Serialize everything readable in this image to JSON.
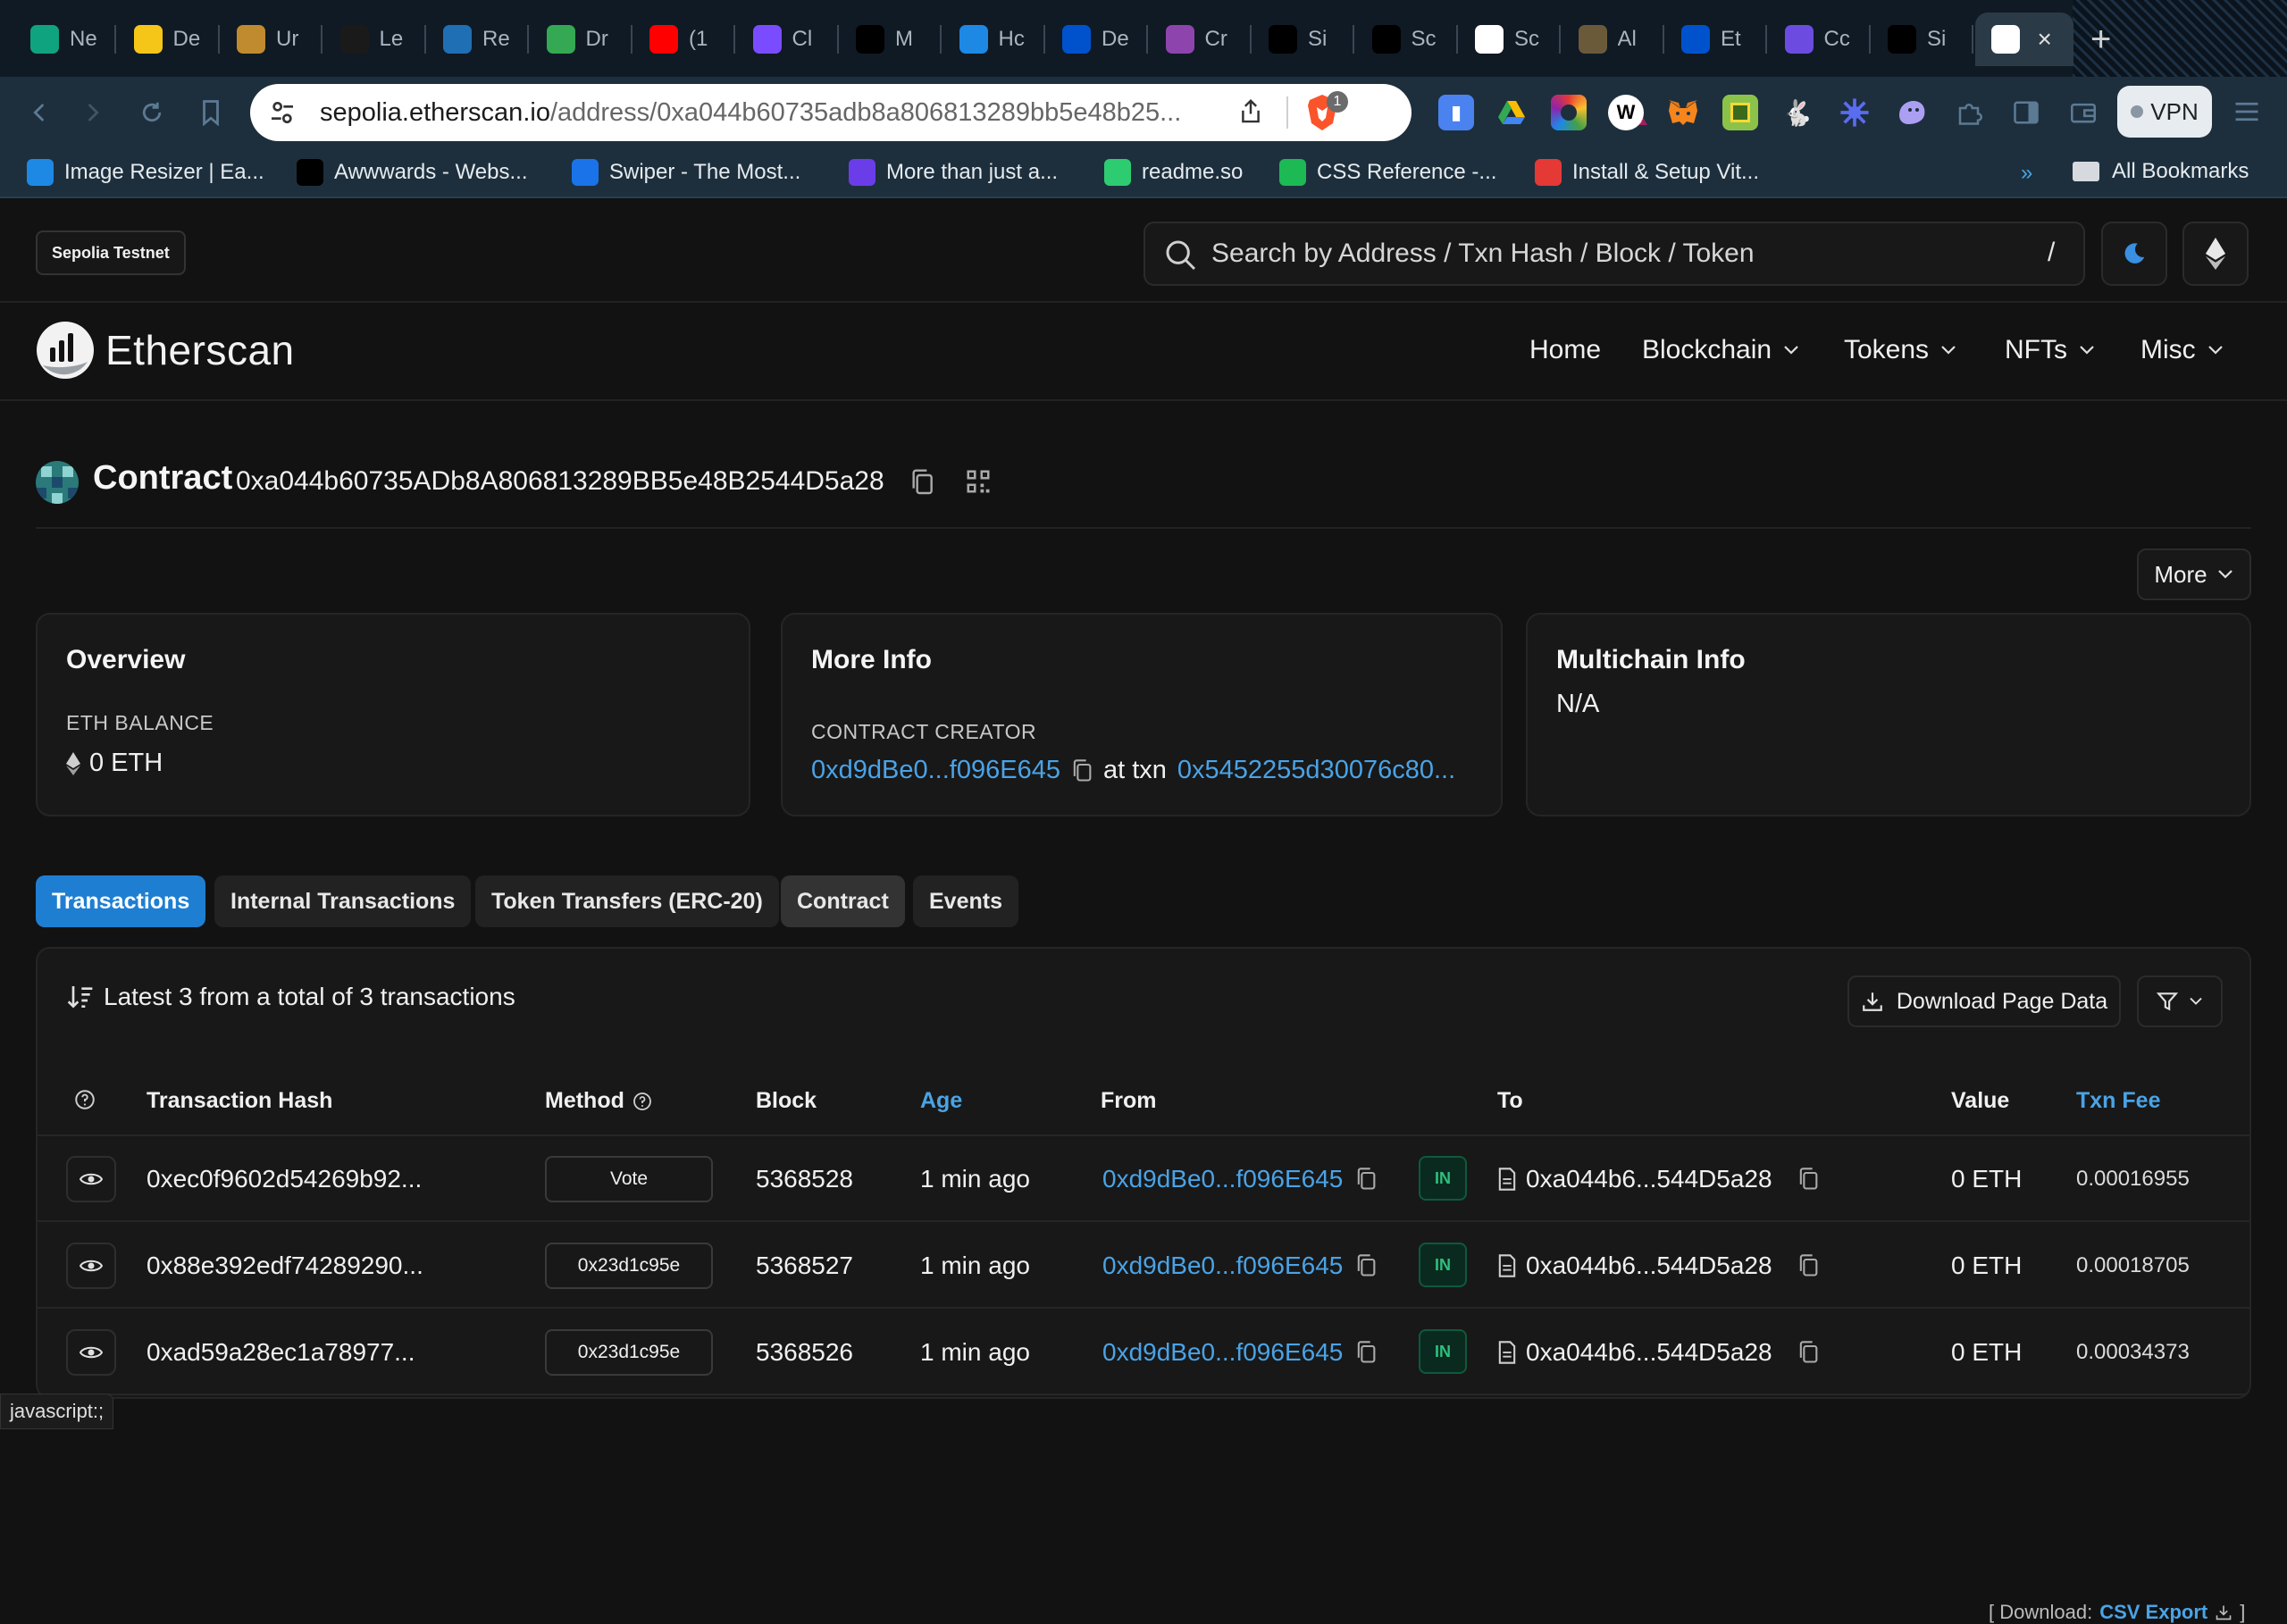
{
  "browser": {
    "tabs": [
      {
        "title": "Ne",
        "icon": "openai-icon",
        "color": "#10a37f"
      },
      {
        "title": "De",
        "icon": "warning-icon",
        "color": "#f5c518"
      },
      {
        "title": "Ur",
        "icon": "m-icon",
        "color": "#c08a2e"
      },
      {
        "title": "Le",
        "icon": "lambda-icon",
        "color": "#1a1a1a"
      },
      {
        "title": "Re",
        "icon": "globe-icon",
        "color": "#1f6fb5"
      },
      {
        "title": "Dr",
        "icon": "drive-icon",
        "color": "#34a853"
      },
      {
        "title": "(1",
        "icon": "youtube-icon",
        "color": "#ff0000"
      },
      {
        "title": "Cl",
        "icon": "ws-icon",
        "color": "#7b4cff"
      },
      {
        "title": "M",
        "icon": "medium-icon",
        "color": "#000000"
      },
      {
        "title": "Hc",
        "icon": "q-icon",
        "color": "#1e88e5"
      },
      {
        "title": "De",
        "icon": "atlassian-icon",
        "color": "#0052cc"
      },
      {
        "title": "Cr",
        "icon": "link-icon",
        "color": "#8e44ad"
      },
      {
        "title": "Si",
        "icon": "medium-icon",
        "color": "#000000"
      },
      {
        "title": "Sc",
        "icon": "medium-icon",
        "color": "#000000"
      },
      {
        "title": "Sc",
        "icon": "google-icon",
        "color": "#ffffff"
      },
      {
        "title": "Al",
        "icon": "m-circle-icon",
        "color": "#6b5a3a"
      },
      {
        "title": "Et",
        "icon": "atlassian-icon",
        "color": "#0052cc"
      },
      {
        "title": "Cc",
        "icon": "list-icon",
        "color": "#6c4ce0"
      },
      {
        "title": "Si",
        "icon": "github-icon",
        "color": "#000000"
      },
      {
        "title": "",
        "icon": "etherscan-icon",
        "color": "#ffffff"
      }
    ],
    "close_glyph": "×",
    "new_tab_glyph": "+",
    "url_domain": "sepolia.etherscan.io",
    "url_path": "/address/0xa044b60735adb8a806813289bb5e48b25...",
    "brave_badge": "1",
    "vpn_label": "VPN",
    "bookmarks": [
      {
        "label": "Image Resizer | Ea...",
        "icon": "resize-icon",
        "color": "#1e88e5"
      },
      {
        "label": "Awwwards - Webs...",
        "icon": "awwwards-icon",
        "color": "#000000"
      },
      {
        "label": "Swiper - The Most...",
        "icon": "swiper-icon",
        "color": "#1a73e8"
      },
      {
        "label": "More than just a...",
        "icon": "six-icon",
        "color": "#6a3de8"
      },
      {
        "label": "readme.so",
        "icon": "readme-icon",
        "color": "#2ecc71"
      },
      {
        "label": "CSS Reference -...",
        "icon": "css-icon",
        "color": "#1db954"
      },
      {
        "label": "Install & Setup Vit...",
        "icon": "vite-icon",
        "color": "#e53935"
      }
    ],
    "bookmarks_more": "»",
    "all_bookmarks": "All Bookmarks"
  },
  "header": {
    "network_badge": "Sepolia Testnet",
    "search_placeholder": "Search by Address / Txn Hash / Block / Token",
    "search_shortcut": "/"
  },
  "nav": {
    "logo_text": "Etherscan",
    "items": [
      {
        "label": "Home",
        "dropdown": false
      },
      {
        "label": "Blockchain",
        "dropdown": true
      },
      {
        "label": "Tokens",
        "dropdown": true
      },
      {
        "label": "NFTs",
        "dropdown": true
      },
      {
        "label": "Misc",
        "dropdown": true
      }
    ]
  },
  "contract": {
    "label": "Contract",
    "address": "0xa044b60735ADb8A806813289BB5e48B2544D5a28"
  },
  "more_button": "More",
  "cards": {
    "overview": {
      "title": "Overview",
      "label": "ETH BALANCE",
      "value": "0 ETH"
    },
    "more_info": {
      "title": "More Info",
      "label": "CONTRACT CREATOR",
      "creator": "0xd9dBe0...f096E645",
      "at_txn": "at txn",
      "txn": "0x5452255d30076c80..."
    },
    "multichain": {
      "title": "Multichain Info",
      "value": "N/A"
    }
  },
  "tabs": [
    {
      "label": "Transactions",
      "state": "active"
    },
    {
      "label": "Internal Transactions",
      "state": "normal"
    },
    {
      "label": "Token Transfers (ERC-20)",
      "state": "normal"
    },
    {
      "label": "Contract",
      "state": "hover"
    },
    {
      "label": "Events",
      "state": "normal"
    }
  ],
  "transactions": {
    "summary": "Latest 3 from a total of 3 transactions",
    "download_label": "Download Page Data",
    "columns": {
      "hash": "Transaction Hash",
      "method": "Method",
      "block": "Block",
      "age": "Age",
      "from": "From",
      "to": "To",
      "value": "Value",
      "fee": "Txn Fee"
    },
    "rows": [
      {
        "hash": "0xec0f9602d54269b92...",
        "method": "Vote",
        "block": "5368528",
        "age": "1 min ago",
        "from": "0xd9dBe0...f096E645",
        "direction": "IN",
        "to": "0xa044b6...544D5a28",
        "value": "0 ETH",
        "fee": "0.00016955"
      },
      {
        "hash": "0x88e392edf74289290...",
        "method": "0x23d1c95e",
        "block": "5368527",
        "age": "1 min ago",
        "from": "0xd9dBe0...f096E645",
        "direction": "IN",
        "to": "0xa044b6...544D5a28",
        "value": "0 ETH",
        "fee": "0.00018705"
      },
      {
        "hash": "0xad59a28ec1a78977...",
        "method": "0x23d1c95e",
        "block": "5368526",
        "age": "1 min ago",
        "from": "0xd9dBe0...f096E645",
        "direction": "IN",
        "to": "0xa044b6...544D5a28",
        "value": "0 ETH",
        "fee": "0.00034373"
      }
    ]
  },
  "status_bar": "javascript:;",
  "csv": {
    "prefix": "[ Download:",
    "link": "CSV Export",
    "suffix": "]"
  }
}
